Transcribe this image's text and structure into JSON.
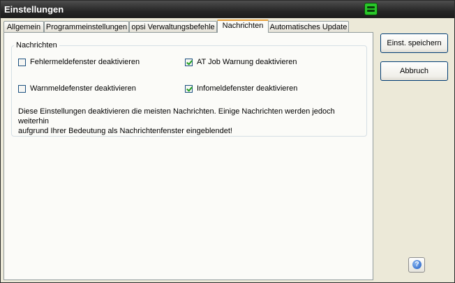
{
  "window": {
    "title": "Einstellungen",
    "app_icon": "opsi-green-icon"
  },
  "tabs": [
    {
      "label": "Allgemein",
      "active": false
    },
    {
      "label": "Programmeinstellungen",
      "active": false
    },
    {
      "label": "opsi Verwaltungsbefehle",
      "active": false
    },
    {
      "label": "Nachrichten",
      "active": true
    },
    {
      "label": "Automatisches Update",
      "active": false
    }
  ],
  "group": {
    "title": "Nachrichten",
    "checkboxes": [
      {
        "label": "Fehlermeldefenster deaktivieren",
        "checked": false
      },
      {
        "label": "AT Job Warnung deaktivieren",
        "checked": true
      },
      {
        "label": "Warnmeldefenster deaktivieren",
        "checked": false
      },
      {
        "label": "Infomeldefenster deaktivieren",
        "checked": true
      }
    ],
    "info_line1": "Diese Einstellungen deaktivieren die meisten Nachrichten. Einige Nachrichten werden jedoch weiterhin",
    "info_line2": "aufgrund Ihrer Bedeutung als Nachrichtenfenster eingeblendet!"
  },
  "buttons": {
    "save": "Einst. speichern",
    "cancel": "Abbruch",
    "help_glyph": "?"
  },
  "colors": {
    "titlebar": "#262626",
    "active_tab_accent": "#e7a03a",
    "check": "#21a121",
    "help": "#1c5bc4"
  }
}
